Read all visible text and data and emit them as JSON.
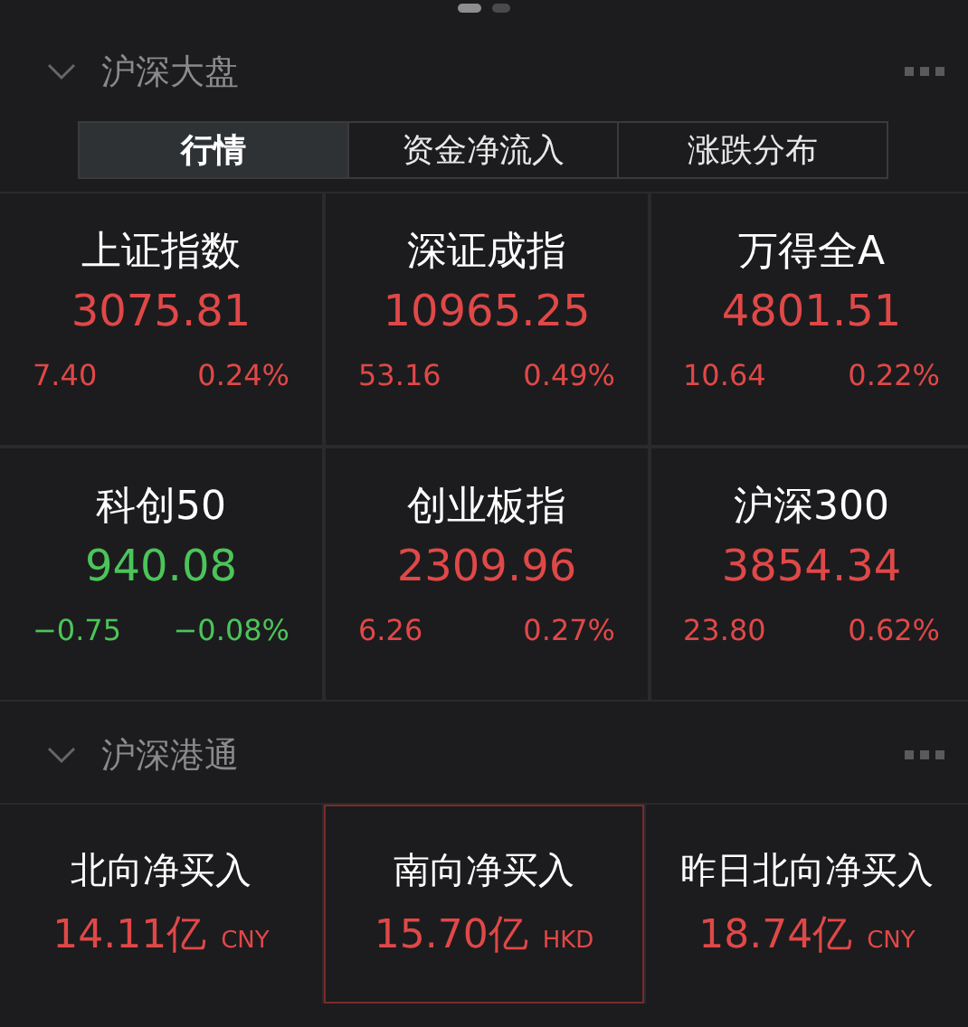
{
  "page_indicator": [
    {
      "selected": true
    },
    {
      "selected": false
    }
  ],
  "sections": [
    {
      "title": "沪深大盘",
      "expanded": true,
      "tabs": [
        {
          "label": "行情",
          "selected": true
        },
        {
          "label": "资金净流入",
          "selected": false
        },
        {
          "label": "涨跌分布",
          "selected": false
        }
      ],
      "quotes": [
        {
          "name": "上证指数",
          "value": "3075.81",
          "change": "7.40",
          "percent": "0.24%",
          "color": "#e04848"
        },
        {
          "name": "深证成指",
          "value": "10965.25",
          "change": "53.16",
          "percent": "0.49%",
          "color": "#e04848"
        },
        {
          "name": "万得全A",
          "value": "4801.51",
          "change": "10.64",
          "percent": "0.22%",
          "color": "#e04848"
        },
        {
          "name": "科创50",
          "value": "940.08",
          "change": "−0.75",
          "percent": "−0.08%",
          "color": "#4cc45a"
        },
        {
          "name": "创业板指",
          "value": "2309.96",
          "change": "6.26",
          "percent": "0.27%",
          "color": "#e04848"
        },
        {
          "name": "沪深300",
          "value": "3854.34",
          "change": "23.80",
          "percent": "0.62%",
          "color": "#e04848"
        }
      ]
    },
    {
      "title": "沪深港通",
      "expanded": true,
      "flows": [
        {
          "label": "北向净买入",
          "amount": "14.11亿",
          "currency": "CNY",
          "selected": false
        },
        {
          "label": "南向净买入",
          "amount": "15.70亿",
          "currency": "HKD",
          "selected": true
        },
        {
          "label": "昨日北向净买入",
          "amount": "18.74亿",
          "currency": "CNY",
          "selected": false
        }
      ]
    }
  ]
}
